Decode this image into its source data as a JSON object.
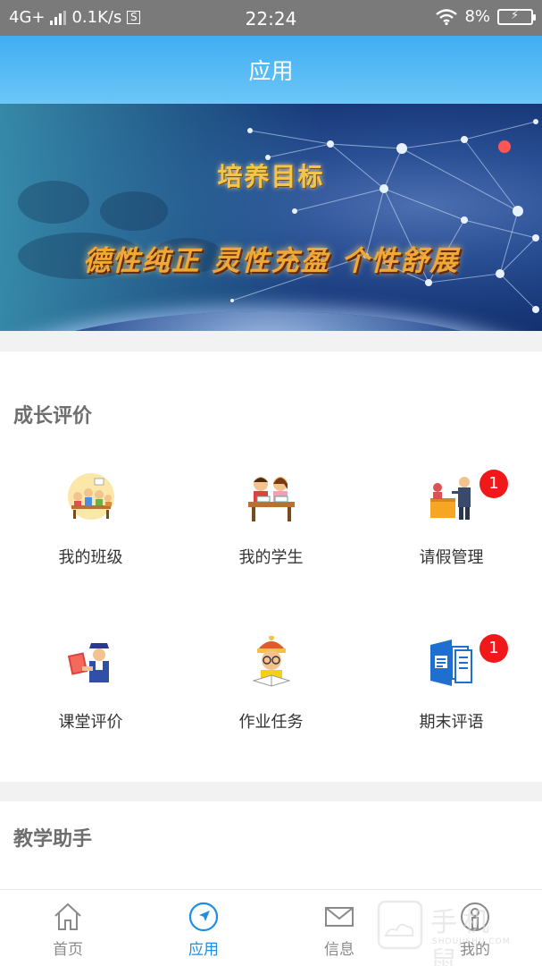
{
  "status_bar": {
    "network": "4G+",
    "speed": "0.1K/s",
    "s_icon": "S",
    "time": "22:24",
    "battery": "8%"
  },
  "header": {
    "title": "应用"
  },
  "banner": {
    "title": "培养目标",
    "slogan": "德性纯正 灵性充盈 个性舒展"
  },
  "sections": [
    {
      "title": "成长评价",
      "items": [
        {
          "label": "我的班级",
          "icon": "class-icon"
        },
        {
          "label": "我的学生",
          "icon": "students-icon"
        },
        {
          "label": "请假管理",
          "icon": "leave-management-icon",
          "badge": "1"
        },
        {
          "label": "课堂评价",
          "icon": "classroom-evaluation-icon"
        },
        {
          "label": "作业任务",
          "icon": "homework-icon"
        },
        {
          "label": "期末评语",
          "icon": "final-comments-icon",
          "badge": "1"
        }
      ]
    },
    {
      "title": "教学助手"
    }
  ],
  "tabbar": [
    {
      "label": "首页",
      "icon": "home-icon"
    },
    {
      "label": "应用",
      "icon": "navigation-icon",
      "active": true
    },
    {
      "label": "信息",
      "icon": "mail-icon"
    },
    {
      "label": "我的",
      "icon": "profile-icon"
    }
  ],
  "watermark": {
    "text": "手机鼠",
    "small": "SHOUJISHU.COM"
  }
}
